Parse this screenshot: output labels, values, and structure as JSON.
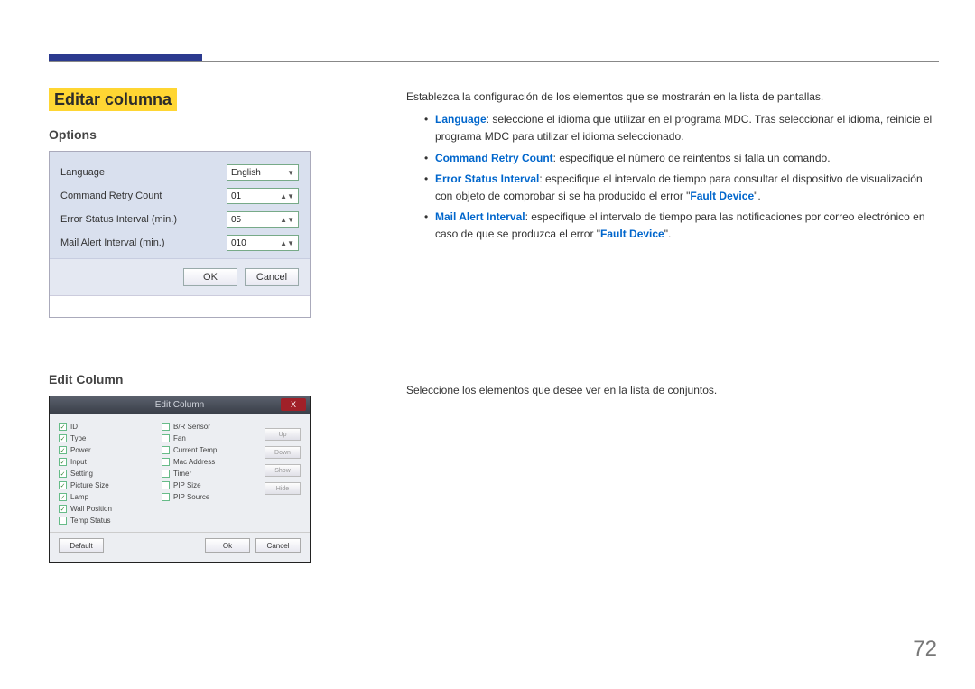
{
  "page": {
    "number": "72",
    "title": "Editar columna"
  },
  "left": {
    "options_heading": "Options",
    "edit_column_heading": "Edit Column"
  },
  "options_dialog": {
    "rows": {
      "language_label": "Language",
      "language_value": "English",
      "retry_label": "Command Retry Count",
      "retry_value": "01",
      "error_label": "Error Status Interval (min.)",
      "error_value": "05",
      "mail_label": "Mail Alert Interval (min.)",
      "mail_value": "010"
    },
    "ok": "OK",
    "cancel": "Cancel"
  },
  "editcol_dialog": {
    "title": "Edit Column",
    "close": "X",
    "left_items": {
      "i0": "ID",
      "i1": "Type",
      "i2": "Power",
      "i3": "Input",
      "i4": "Setting",
      "i5": "Picture Size",
      "i6": "Lamp",
      "i7": "Wall Position",
      "i8": "Temp Status"
    },
    "right_items": {
      "r0": "B/R Sensor",
      "r1": "Fan",
      "r2": "Current Temp.",
      "r3": "Mac Address",
      "r4": "Timer",
      "r5": "PIP Size",
      "r6": "PIP Source"
    },
    "side": {
      "up": "Up",
      "down": "Down",
      "show": "Show",
      "hide": "Hide"
    },
    "default": "Default",
    "ok": "Ok",
    "cancel": "Cancel"
  },
  "right": {
    "intro": "Establezca la configuración de los elementos que se mostrarán en la lista de pantallas.",
    "lang_key": "Language",
    "lang_text": ": seleccione el idioma que utilizar en el programa MDC. Tras seleccionar el idioma, reinicie el programa MDC para utilizar el idioma seleccionado.",
    "retry_key": "Command Retry Count",
    "retry_text": ": especifique el número de reintentos si falla un comando.",
    "error_key": "Error Status Interval",
    "error_text_a": ": especifique el intervalo de tiempo para consultar el dispositivo de visualización con objeto de comprobar si se ha producido el error \"",
    "fault_device": "Fault Device",
    "error_text_b": "\".",
    "mail_key": "Mail Alert Interval",
    "mail_text_a": ": especifique el intervalo de tiempo para las notificaciones por correo electrónico en caso de que se produzca el error \"",
    "mail_text_b": "\".",
    "edit_desc": "Seleccione los elementos que desee ver en la lista de conjuntos."
  }
}
